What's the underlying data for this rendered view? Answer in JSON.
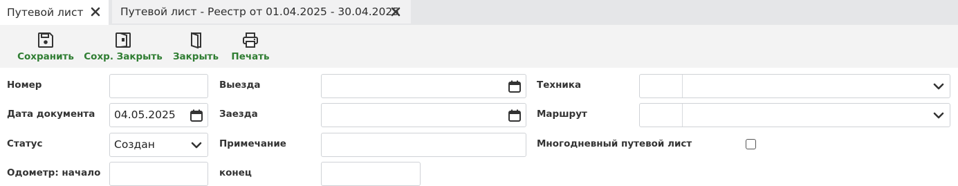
{
  "tabs": [
    {
      "label": "Путевой лист",
      "active": true
    },
    {
      "label": "Путевой лист - Реестр от 01.04.2025 - 30.04.2025",
      "active": false
    }
  ],
  "toolbar": {
    "save": "Сохранить",
    "save_close": "Сохр. Закрыть",
    "close": "Закрыть",
    "print": "Печать"
  },
  "form": {
    "number_label": "Номер",
    "number_value": "",
    "doc_date_label": "Дата документа",
    "doc_date_value": "04.05.2025",
    "status_label": "Статус",
    "status_value": "Создан",
    "odometer_start_label": "Одометр: начало",
    "odometer_start_value": "",
    "departure_label": "Выезда",
    "departure_value": "",
    "arrival_label": "Заезда",
    "arrival_value": "",
    "note_label": "Примечание",
    "note_value": "",
    "odometer_end_label": "конец",
    "odometer_end_value": "",
    "vehicle_label": "Техника",
    "vehicle_code": "",
    "vehicle_value": "",
    "route_label": "Маршрут",
    "route_code": "",
    "route_value": "",
    "multiday_label": "Многодневный путевой лист",
    "multiday_checked": false
  },
  "colors": {
    "accent": "#2f7d32",
    "tabbar_bg": "#e5e6e8",
    "toolbar_bg": "#f3f3f3",
    "border": "#cfd2d6"
  }
}
